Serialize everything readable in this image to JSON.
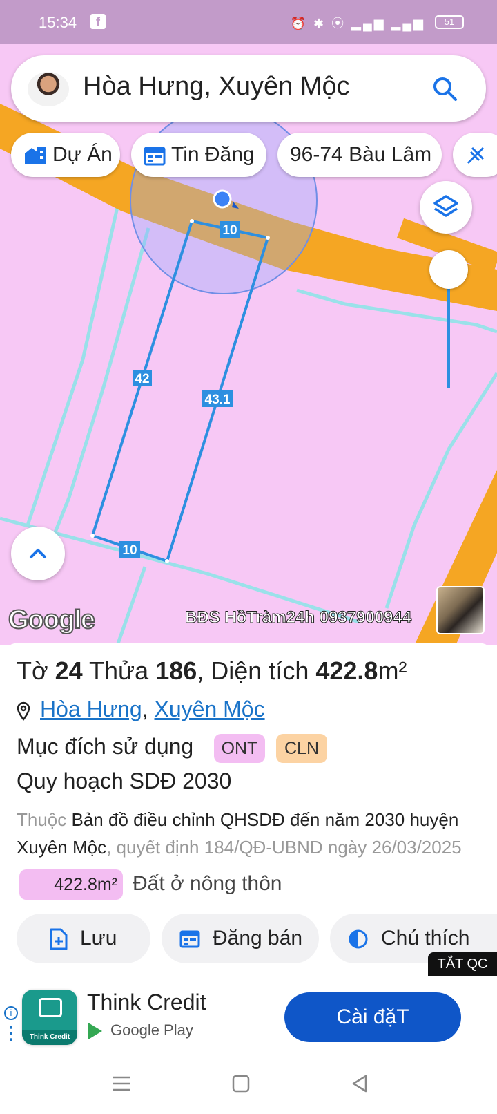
{
  "status_bar": {
    "time": "15:34",
    "battery": "51"
  },
  "search": {
    "query": "Hòa Hưng, Xuyên Mộc"
  },
  "chips": [
    {
      "label": "Dự Án",
      "icon": "building-icon"
    },
    {
      "label": "Tin Đăng",
      "icon": "calendar-icon"
    },
    {
      "label": "96-74 Bàu Lâm",
      "icon": ""
    }
  ],
  "map": {
    "edge_labels": [
      "10",
      "42",
      "43.1",
      "10"
    ],
    "google_logo": "Google",
    "watermark": "BĐS HồTràm24h 0937900944",
    "fill_color": "#f7c8f5",
    "road_color": "#f5a623",
    "parcel_color": "#2d8fe0"
  },
  "parcel": {
    "sheet_label": "Tờ",
    "sheet": "24",
    "lot_label": "Thửa",
    "lot": "186",
    "area_label": ", Diện tích",
    "area": "422.8",
    "area_unit": "m²",
    "ward": "Hòa Hưng",
    "district": "Xuyên Mộc",
    "purpose_label": "Mục đích sử dụng",
    "badges": [
      {
        "code": "ONT",
        "color": "#f3bdf2"
      },
      {
        "code": "CLN",
        "color": "#fcd3a3"
      }
    ],
    "plan_title": "Quy hoạch SDĐ 2030",
    "desc_prefix": "Thuộc",
    "desc_main": "Bản đồ điều chỉnh QHSDĐ đến năm 2030 huyện Xuyên Mộc",
    "desc_suffix": ", quyết định 184/QĐ-UBND ngày 26/03/2025",
    "zone_area": "422.8m²",
    "zone_name": "Đất ở nông thôn"
  },
  "actions": [
    {
      "label": "Lưu"
    },
    {
      "label": "Đăng bán"
    },
    {
      "label": "Chú thích"
    }
  ],
  "ad": {
    "hide_label": "TẮT QC",
    "app_name": "Think Credit",
    "icon_label": "Think Credit",
    "store": "Google Play",
    "install_label": "Cài đặT"
  }
}
